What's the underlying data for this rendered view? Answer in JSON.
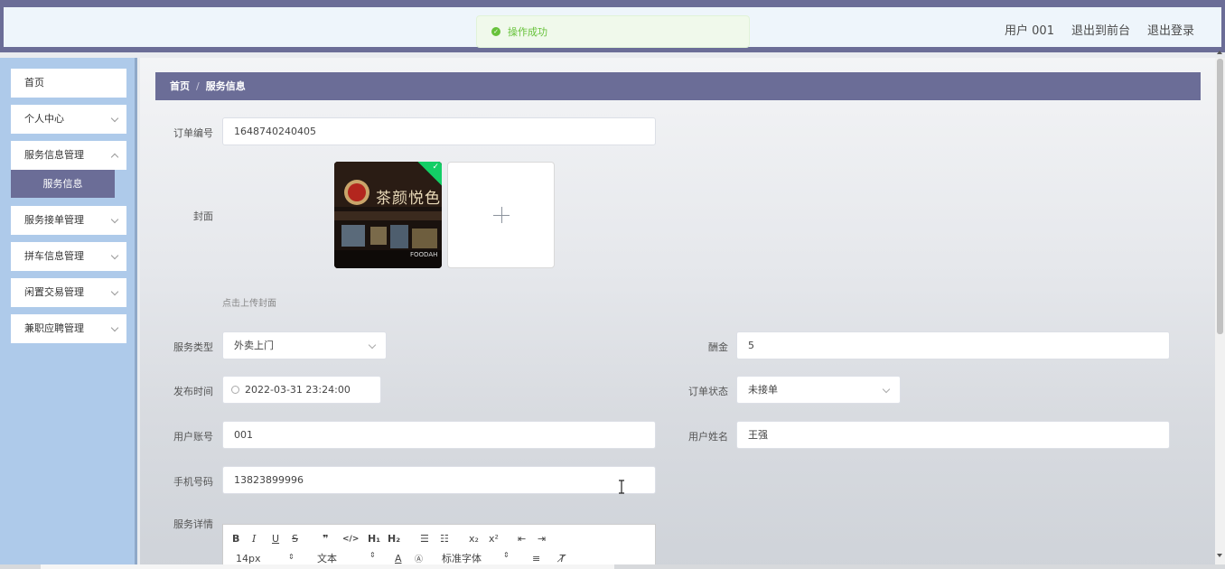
{
  "header": {
    "user_label": "用户 001",
    "back_to_front_label": "退出到前台",
    "logout_label": "退出登录"
  },
  "toast": {
    "message": "操作成功",
    "color": "#67c23a"
  },
  "sidebar": {
    "items": [
      {
        "label": "首页"
      },
      {
        "label": "个人中心"
      },
      {
        "label": "服务信息管理"
      },
      {
        "label": "服务接单管理"
      },
      {
        "label": "拼车信息管理"
      },
      {
        "label": "闲置交易管理"
      },
      {
        "label": "兼职应聘管理"
      }
    ],
    "active_sub": "服务信息"
  },
  "breadcrumb": {
    "home": "首页",
    "separator": "/",
    "current": "服务信息"
  },
  "form": {
    "order_no": {
      "label": "订单编号",
      "value": "1648740240405"
    },
    "cover": {
      "label": "封面",
      "hint": "点击上传封面",
      "image_text": "茶颜悦色",
      "image_brand": "FOODAH"
    },
    "service_type": {
      "label": "服务类型",
      "value": "外卖上门"
    },
    "reward": {
      "label": "酬金",
      "value": "5"
    },
    "publish_time": {
      "label": "发布时间",
      "value": "2022-03-31 23:24:00"
    },
    "order_status": {
      "label": "订单状态",
      "value": "未接单"
    },
    "user_account": {
      "label": "用户账号",
      "value": "001"
    },
    "user_name": {
      "label": "用户姓名",
      "value": "王强"
    },
    "phone": {
      "label": "手机号码",
      "value": "13823899996"
    },
    "detail": {
      "label": "服务详情"
    }
  },
  "editor": {
    "font_size": "14px",
    "block_type": "文本",
    "font_family": "标准字体"
  },
  "colors": {
    "accent": "#6b6d97",
    "sidebar_bg": "#aecaea"
  }
}
